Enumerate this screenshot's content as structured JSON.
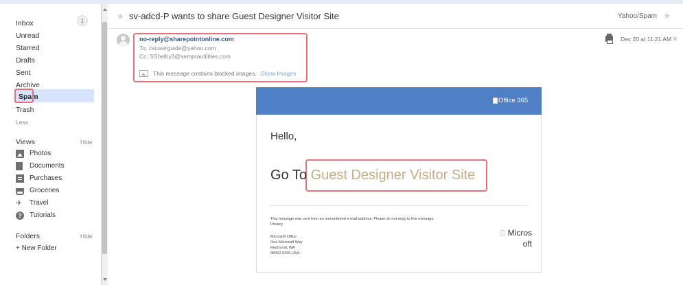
{
  "sidebar": {
    "folders": [
      {
        "label": "Inbox",
        "count": "1"
      },
      {
        "label": "Unread"
      },
      {
        "label": "Starred"
      },
      {
        "label": "Drafts"
      },
      {
        "label": "Sent"
      },
      {
        "label": "Archive"
      },
      {
        "label": "Spam",
        "selected": true
      },
      {
        "label": "Trash"
      }
    ],
    "less_label": "Less",
    "views_title": "Views",
    "views_hide": "Hide",
    "views": [
      {
        "label": "Photos",
        "icon": "photos-icon"
      },
      {
        "label": "Documents",
        "icon": "document-icon"
      },
      {
        "label": "Purchases",
        "icon": "receipt-icon"
      },
      {
        "label": "Groceries",
        "icon": "basket-icon"
      },
      {
        "label": "Travel",
        "icon": "plane-icon"
      },
      {
        "label": "Tutorials",
        "icon": "tips-icon"
      }
    ],
    "folders_title": "Folders",
    "folders_hide": "Hide",
    "new_folder": "+ New Folder"
  },
  "header": {
    "subject": "sv-adcd-P wants to share Guest Designer Visitor Site",
    "folder_tag": "Yahoo/Spam",
    "star": "★"
  },
  "message": {
    "from": "no-reply@sharepointonline.com",
    "to": "To: csiuserguide@yahoo.com",
    "cc": "Cc: SShelby3@semprautilities.com",
    "blocked_notice": "This message contains blocked images.",
    "show_images": "Show Images",
    "date": "Dec 20 at 11:21 AM",
    "star": "★"
  },
  "email_body": {
    "banner_logo_alt": "Office 365",
    "greeting": "Hello,",
    "goto_prefix": "Go To",
    "goto_link": "Guest Designer Visitor Site",
    "footer_note": "This message was sent from an unmonitored e-mail address. Please do not reply to this message.",
    "privacy": "Privacy",
    "address": [
      "Microsoft Office",
      "One Microsoft Way",
      "Redmond, WA",
      "98052-6399 USA"
    ],
    "ms_logo_alt": "Micros oft"
  },
  "colors": {
    "accent_blue": "#4f7fc5",
    "highlight_box": "#e8707a",
    "link_tan": "#c9ab86",
    "spam_selected_bg": "#d5e3fb"
  }
}
